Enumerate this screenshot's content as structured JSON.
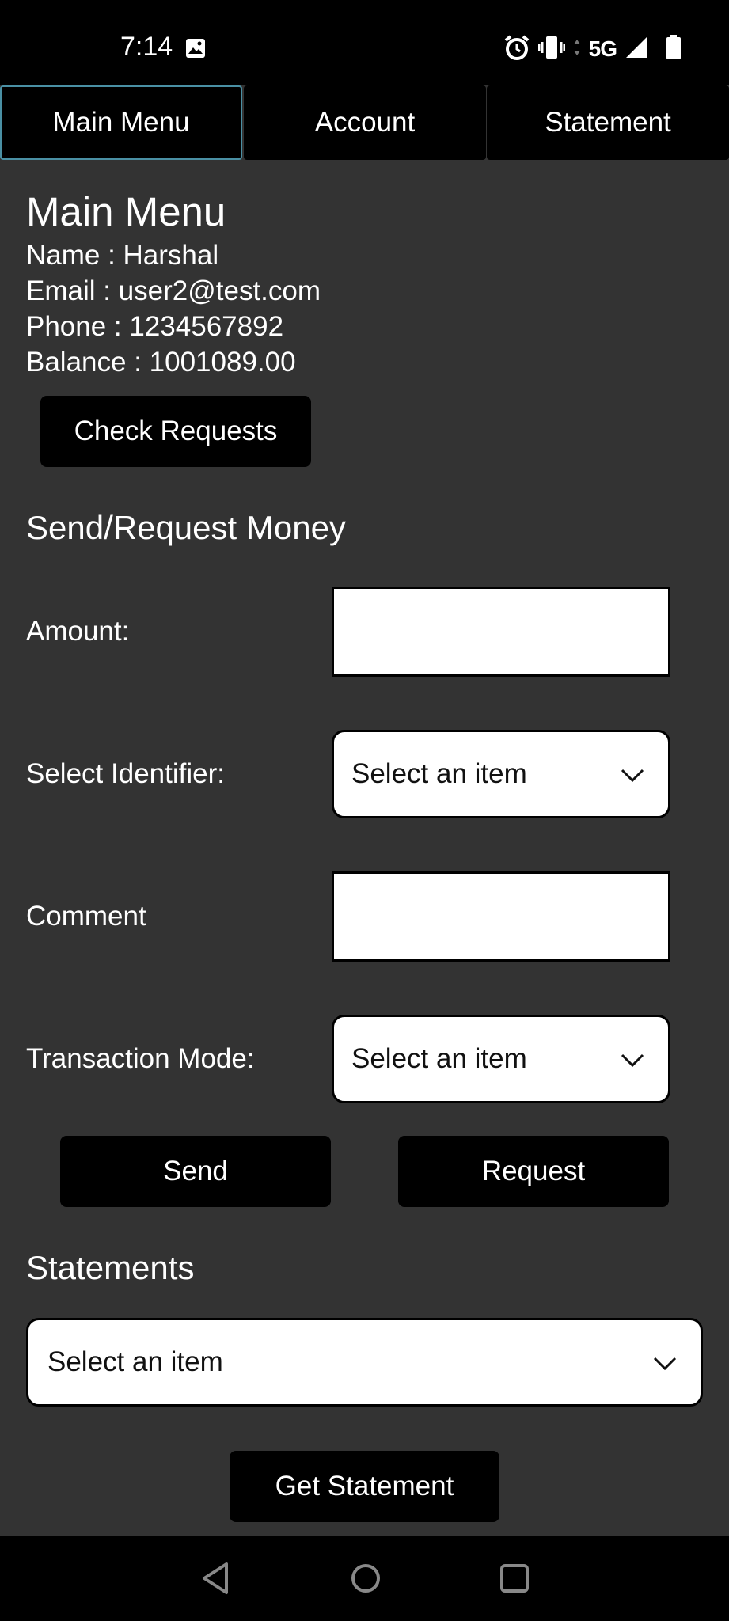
{
  "status_bar": {
    "time": "7:14",
    "network": "5G",
    "icons": [
      "image-icon",
      "alarm-icon",
      "vibrate-icon",
      "signal-icon",
      "battery-icon"
    ]
  },
  "tabs": [
    {
      "label": "Main Menu",
      "active": true
    },
    {
      "label": "Account",
      "active": false
    },
    {
      "label": "Statement",
      "active": false
    }
  ],
  "main": {
    "title": "Main Menu",
    "name": "Name : Harshal",
    "email": "Email : user2@test.com",
    "phone": "Phone : 1234567892",
    "balance": "Balance : 1001089.00",
    "check_requests_label": "Check Requests"
  },
  "send_request": {
    "title": "Send/Request Money",
    "amount_label": "Amount:",
    "amount_value": "",
    "identifier_label": "Select Identifier:",
    "identifier_value": "Select an item",
    "comment_label": "Comment",
    "comment_value": "",
    "mode_label": "Transaction Mode:",
    "mode_value": "Select an item",
    "send_label": "Send",
    "request_label": "Request"
  },
  "statements": {
    "title": "Statements",
    "select_value": "Select an item",
    "get_statement_label": "Get Statement"
  },
  "colors": {
    "background": "#333333",
    "bar": "#000000",
    "active_tab_border": "#4a90a4",
    "text": "#ffffff"
  }
}
